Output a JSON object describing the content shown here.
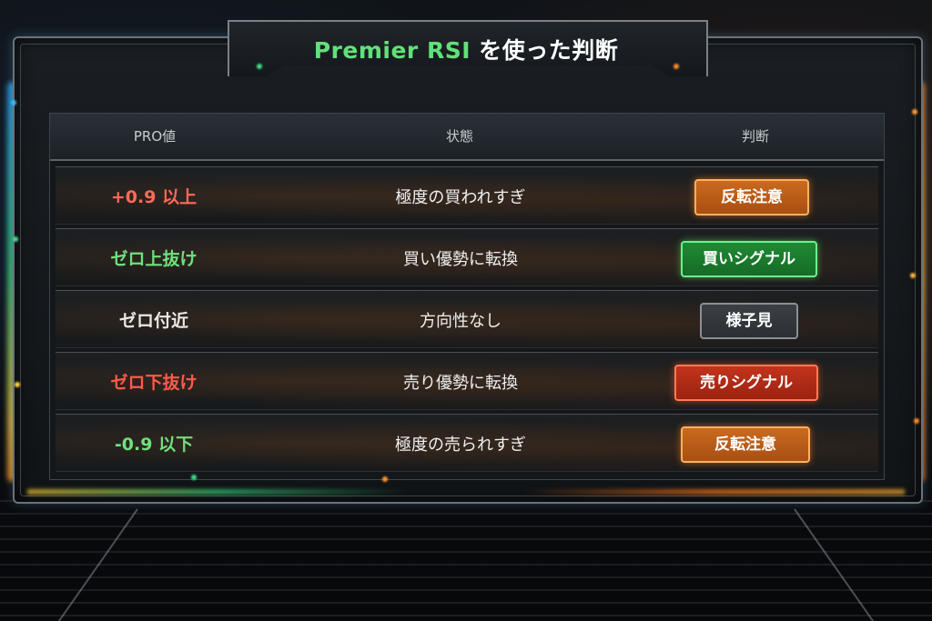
{
  "title": {
    "accent": "Premier RSI",
    "rest": " を使った判断"
  },
  "table": {
    "headers": {
      "pro": "PRO値",
      "state": "状態",
      "judge": "判断"
    },
    "rows": [
      {
        "pro": "+0.9 以上",
        "state": "極度の買われすぎ",
        "judge": "反転注意",
        "pro_color": "#ff6a5a",
        "judge_style": "orange"
      },
      {
        "pro": "ゼロ上抜け",
        "state": "買い優勢に転換",
        "judge": "買いシグナル",
        "pro_color": "#6fe07e",
        "judge_style": "green"
      },
      {
        "pro": "ゼロ付近",
        "state": "方向性なし",
        "judge": "様子見",
        "pro_color": "#e8e8e8",
        "judge_style": "gray"
      },
      {
        "pro": "ゼロ下抜け",
        "state": "売り優勢に転換",
        "judge": "売りシグナル",
        "pro_color": "#ff5a4a",
        "judge_style": "red"
      },
      {
        "pro": "-0.9 以下",
        "state": "極度の売られすぎ",
        "judge": "反転注意",
        "pro_color": "#6fe07e",
        "judge_style": "orange"
      }
    ]
  },
  "colors": {
    "accent_green": "#63e07a",
    "orange": "#ff8a1f",
    "blue_glow": "#2aa8ff"
  }
}
